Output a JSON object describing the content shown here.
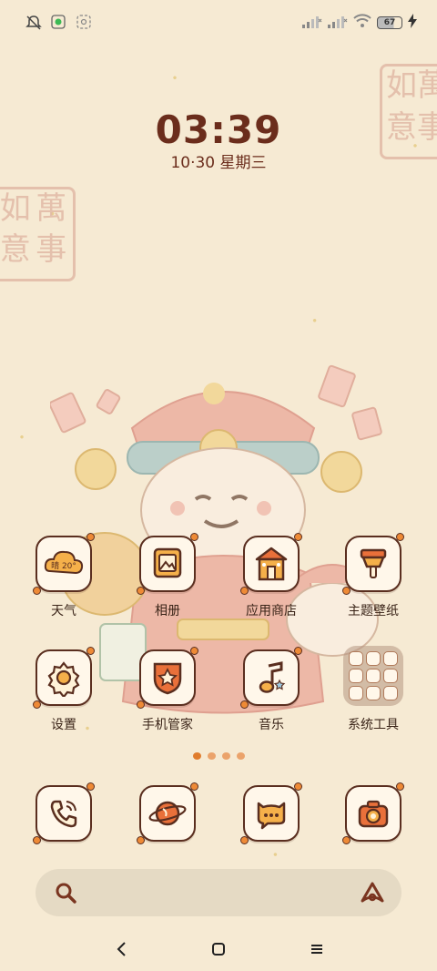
{
  "status_bar": {
    "battery_level": "67"
  },
  "lock": {
    "time": "03:39",
    "date": "10·30  星期三"
  },
  "seals": {
    "top_right": [
      "萬",
      "如",
      "事",
      "意"
    ],
    "left": [
      "萬",
      "如",
      "事",
      "意"
    ]
  },
  "apps": [
    {
      "label": "天气",
      "icon": "weather-icon",
      "badge": "晴 20°"
    },
    {
      "label": "相册",
      "icon": "gallery-icon"
    },
    {
      "label": "应用商店",
      "icon": "app-store-icon"
    },
    {
      "label": "主题壁纸",
      "icon": "themes-icon"
    },
    {
      "label": "设置",
      "icon": "settings-icon"
    },
    {
      "label": "手机管家",
      "icon": "security-icon"
    },
    {
      "label": "音乐",
      "icon": "music-icon"
    },
    {
      "label": "系统工具",
      "icon": "folder-icon"
    }
  ],
  "dock": [
    {
      "icon": "phone-icon"
    },
    {
      "icon": "browser-icon"
    },
    {
      "icon": "messages-icon"
    },
    {
      "icon": "camera-icon"
    }
  ],
  "page_indicator": {
    "count": 4,
    "active": 0
  },
  "colors": {
    "background": "#f6ead3",
    "accent": "#e07c2c",
    "ink": "#5a2e1f",
    "clock": "#6b2d1c"
  }
}
